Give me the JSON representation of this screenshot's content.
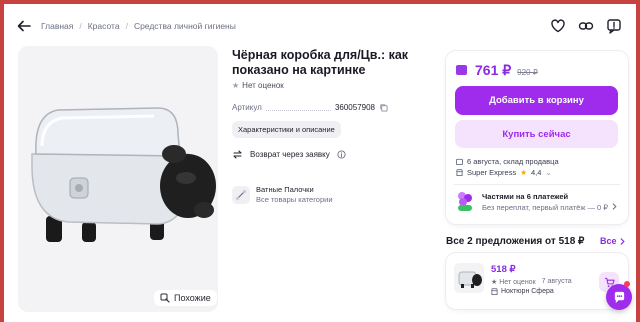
{
  "breadcrumbs": [
    "Главная",
    "Красота",
    "Средства личной гигиены"
  ],
  "product": {
    "title": "Чёрная коробка для/Цв.: как показано на картинке",
    "rating_text": "Нет оценок",
    "article_label": "Артикул",
    "article_value": "360057908",
    "characteristics_button": "Характеристики и описание",
    "return_text": "Возврат через заявку",
    "category_name": "Ватные Палочки",
    "category_link": "Все товары категории",
    "similar_button": "Похожие"
  },
  "buy": {
    "price": "761 ₽",
    "old_price": "920 ₽",
    "add_to_cart": "Добавить в корзину",
    "buy_now": "Купить сейчас",
    "delivery_line": "6 августа, склад продавца",
    "seller_name": "Super Express",
    "seller_rating": "4,4",
    "installments_title": "Частями на 6 платежей",
    "installments_sub": "Без переплат, первый платёж — 0 ₽"
  },
  "offers": {
    "title": "Все 2 предложения от 518 ₽",
    "all_link": "Все",
    "item": {
      "price": "518 ₽",
      "rating": "Нет оценок",
      "date": "7 августа",
      "seller": "Ноктюрн Сфера"
    }
  },
  "icons": {
    "back": "arrow-left-icon",
    "favorite": "heart-icon",
    "share": "link-icon",
    "report": "report-icon",
    "chat": "chat-icon"
  },
  "colors": {
    "accent": "#9f2bed",
    "accent_light": "#f5e3fd",
    "frame": "#c8433f"
  }
}
